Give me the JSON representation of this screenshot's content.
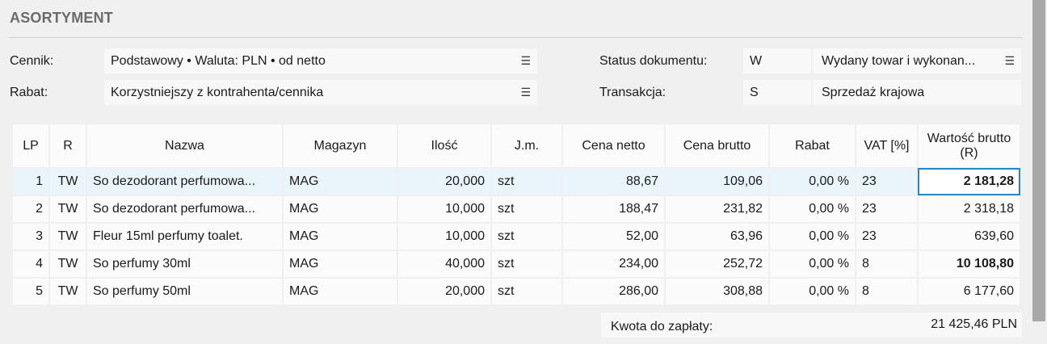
{
  "section": {
    "title": "ASORTYMENT"
  },
  "fields": {
    "cennik": {
      "label": "Cennik:",
      "value": "Podstawowy • Waluta: PLN • od netto"
    },
    "rabat": {
      "label": "Rabat:",
      "value": "Korzystniejszy z kontrahenta/cennika"
    },
    "status": {
      "label": "Status dokumentu:",
      "code": "W",
      "value": "Wydany towar i wykonan..."
    },
    "transakcja": {
      "label": "Transakcja:",
      "code": "S",
      "value": "Sprzedaż krajowa"
    },
    "menu_glyph": "☰"
  },
  "table": {
    "headers": {
      "lp": "LP",
      "r": "R",
      "nazwa": "Nazwa",
      "magazyn": "Magazyn",
      "ilosc": "Ilość",
      "jm": "J.m.",
      "cena_netto": "Cena netto",
      "cena_brutto": "Cena brutto",
      "rabat": "Rabat",
      "vat": "VAT [%]",
      "wartosc": "Wartość brutto (R)"
    },
    "rows": [
      {
        "lp": "1",
        "r": "TW",
        "nazwa": "So dezodorant perfumowa...",
        "magazyn": "MAG",
        "ilosc": "20,000",
        "jm": "szt",
        "cena_netto": "88,67",
        "cena_brutto": "109,06",
        "rabat": "0,00 %",
        "vat": "23",
        "wartosc": "2 181,28"
      },
      {
        "lp": "2",
        "r": "TW",
        "nazwa": "So dezodorant perfumowa...",
        "magazyn": "MAG",
        "ilosc": "10,000",
        "jm": "szt",
        "cena_netto": "188,47",
        "cena_brutto": "231,82",
        "rabat": "0,00 %",
        "vat": "23",
        "wartosc": "2 318,18"
      },
      {
        "lp": "3",
        "r": "TW",
        "nazwa": "Fleur 15ml perfumy toalet.",
        "magazyn": "MAG",
        "ilosc": "10,000",
        "jm": "szt",
        "cena_netto": "52,00",
        "cena_brutto": "63,96",
        "rabat": "0,00 %",
        "vat": "23",
        "wartosc": "639,60"
      },
      {
        "lp": "4",
        "r": "TW",
        "nazwa": "So perfumy 30ml",
        "magazyn": "MAG",
        "ilosc": "40,000",
        "jm": "szt",
        "cena_netto": "234,00",
        "cena_brutto": "252,72",
        "rabat": "0,00 %",
        "vat": "8",
        "wartosc": "10 108,80"
      },
      {
        "lp": "5",
        "r": "TW",
        "nazwa": "So perfumy 50ml",
        "magazyn": "MAG",
        "ilosc": "20,000",
        "jm": "szt",
        "cena_netto": "286,00",
        "cena_brutto": "308,88",
        "rabat": "0,00 %",
        "vat": "8",
        "wartosc": "6 177,60"
      }
    ]
  },
  "total": {
    "label": "Kwota do zapłaty:",
    "value": "21 425,46 PLN"
  },
  "colors": {
    "accent": "#2a85c5",
    "selected_row": "#eaf5fb",
    "title": "#6b6b6b"
  }
}
